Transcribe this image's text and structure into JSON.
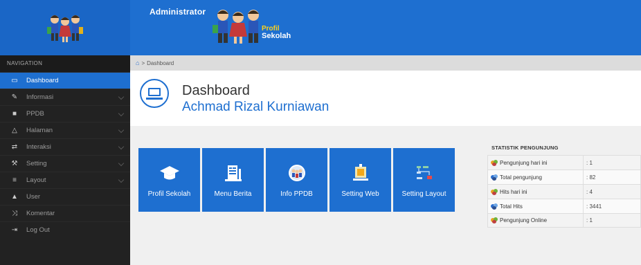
{
  "header": {
    "brand_admin": "Administrator",
    "brand_profil": "Profil",
    "brand_sekolah": "Sekolah"
  },
  "sidebar": {
    "heading": "NAVIGATION",
    "items": [
      {
        "label": "Dashboard",
        "icon": "laptop-icon",
        "active": true,
        "has_chevron": false
      },
      {
        "label": "Informasi",
        "icon": "pencil-icon",
        "active": false,
        "has_chevron": true
      },
      {
        "label": "PPDB",
        "icon": "book-icon",
        "active": false,
        "has_chevron": true
      },
      {
        "label": "Halaman",
        "icon": "bell-icon",
        "active": false,
        "has_chevron": true
      },
      {
        "label": "Interaksi",
        "icon": "ticket-icon",
        "active": false,
        "has_chevron": true
      },
      {
        "label": "Setting",
        "icon": "wrench-icon",
        "active": false,
        "has_chevron": true
      },
      {
        "label": "Layout",
        "icon": "list-icon",
        "active": false,
        "has_chevron": true
      },
      {
        "label": "User",
        "icon": "user-icon",
        "active": false,
        "has_chevron": false
      },
      {
        "label": "Komentar",
        "icon": "shuffle-icon",
        "active": false,
        "has_chevron": false
      },
      {
        "label": "Log Out",
        "icon": "logout-icon",
        "active": false,
        "has_chevron": false
      }
    ]
  },
  "breadcrumb": {
    "home_icon": "home-icon",
    "separator": ">",
    "current": "Dashboard"
  },
  "page": {
    "title": "Dashboard",
    "subtitle": "Achmad Rizal Kurniawan"
  },
  "tiles": [
    {
      "label": "Profil Sekolah",
      "icon": "graduation-cap-icon"
    },
    {
      "label": "Menu Berita",
      "icon": "news-icon"
    },
    {
      "label": "Info PPDB",
      "icon": "kids-badge-icon"
    },
    {
      "label": "Setting Web",
      "icon": "web-frame-icon"
    },
    {
      "label": "Setting Layout",
      "icon": "layout-flow-icon"
    }
  ],
  "stats": {
    "title": "STATISTIK PENGUNJUNG",
    "rows": [
      {
        "label": "Pengunjung hari ini",
        "value": ": 1",
        "icon_color": "#e8a020"
      },
      {
        "label": "Total pengunjung",
        "value": ": 82",
        "icon_color": "#2c6fcf"
      },
      {
        "label": "Hits hari ini",
        "value": ": 4",
        "icon_color": "#e8a020"
      },
      {
        "label": "Total Hits",
        "value": ": 3441",
        "icon_color": "#2c6fcf"
      },
      {
        "label": "Pengunjung Online",
        "value": ": 1",
        "icon_color": "#e8a020"
      }
    ]
  },
  "colors": {
    "accent": "#1e6fd0",
    "sidebar_bg": "#222222"
  }
}
